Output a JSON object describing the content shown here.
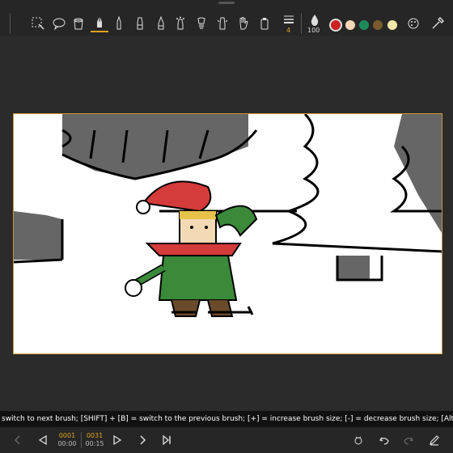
{
  "status_message": "switch to next brush; [SHIFT] + [B] = switch to the previous brush; [+] = increase brush size; [-] = decrease brush size; [Alt] = pick color",
  "toolbar": {
    "brush_size": "4",
    "opacity": "100",
    "active_tool": "pen-tool",
    "colors": [
      "#cc2222",
      "#f2d7b6",
      "#1e8a5c",
      "#7b5a2e",
      "#f5e6a8"
    ]
  },
  "timeline": {
    "current_frame": "0001",
    "current_time": "00:00",
    "total_frames": "0031",
    "total_time": "00:15"
  },
  "accent_color": "#e2a321"
}
